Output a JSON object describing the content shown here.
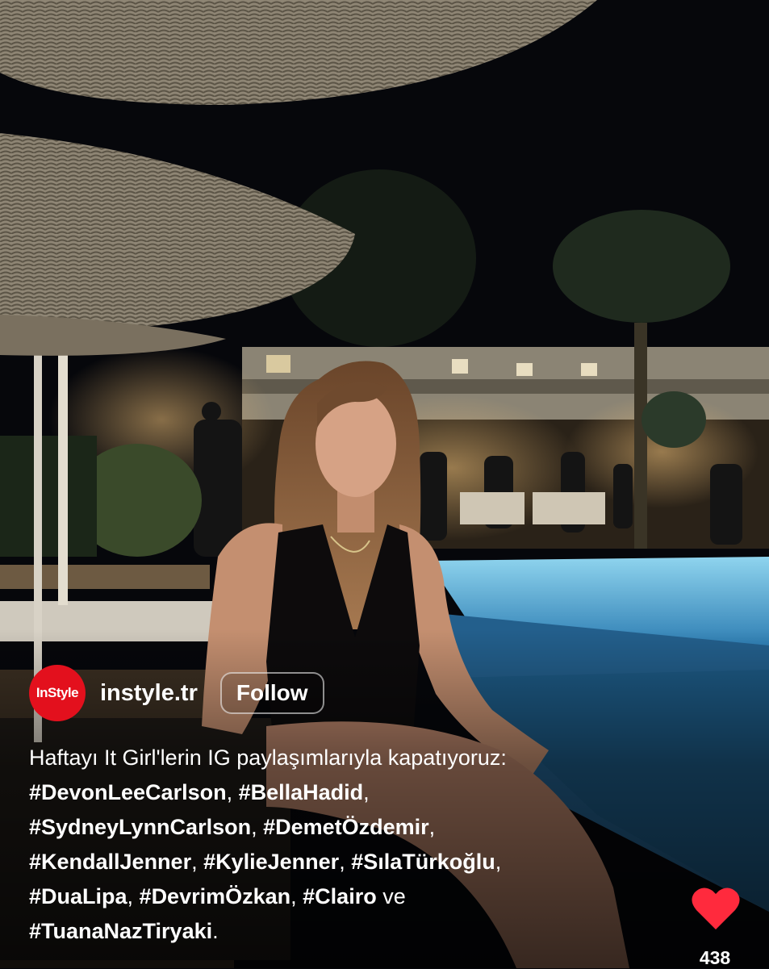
{
  "post": {
    "photo_icon": "photo-pool-party-night",
    "author": {
      "avatar_text": "InStyle",
      "handle": "instyle.tr",
      "follow_label": "Follow"
    },
    "caption": {
      "line1": "Haftayı It Girl'lerin IG paylaşımlarıyla kapatıyoruz:",
      "tag1": "#DevonLeeCarlson",
      "tag2": "#BellaHadid",
      "tag3": "#SydneyLynnCarlson",
      "tag4": "#DemetÖzdemir",
      "tag5": "#KendallJenner",
      "tag6": "#KylieJenner",
      "tag7": "#SılaTürkoğlu",
      "tag8": "#DuaLipa",
      "tag9": "#DevrimÖzkan",
      "tag10": "#Clairo",
      "conj": "ve",
      "tag11": "#TuanaNazTiryaki"
    },
    "likes": {
      "icon": "heart-icon",
      "count": "438"
    },
    "colors": {
      "accent_red": "#e3101d",
      "heart_red": "#ff2a3d"
    }
  }
}
